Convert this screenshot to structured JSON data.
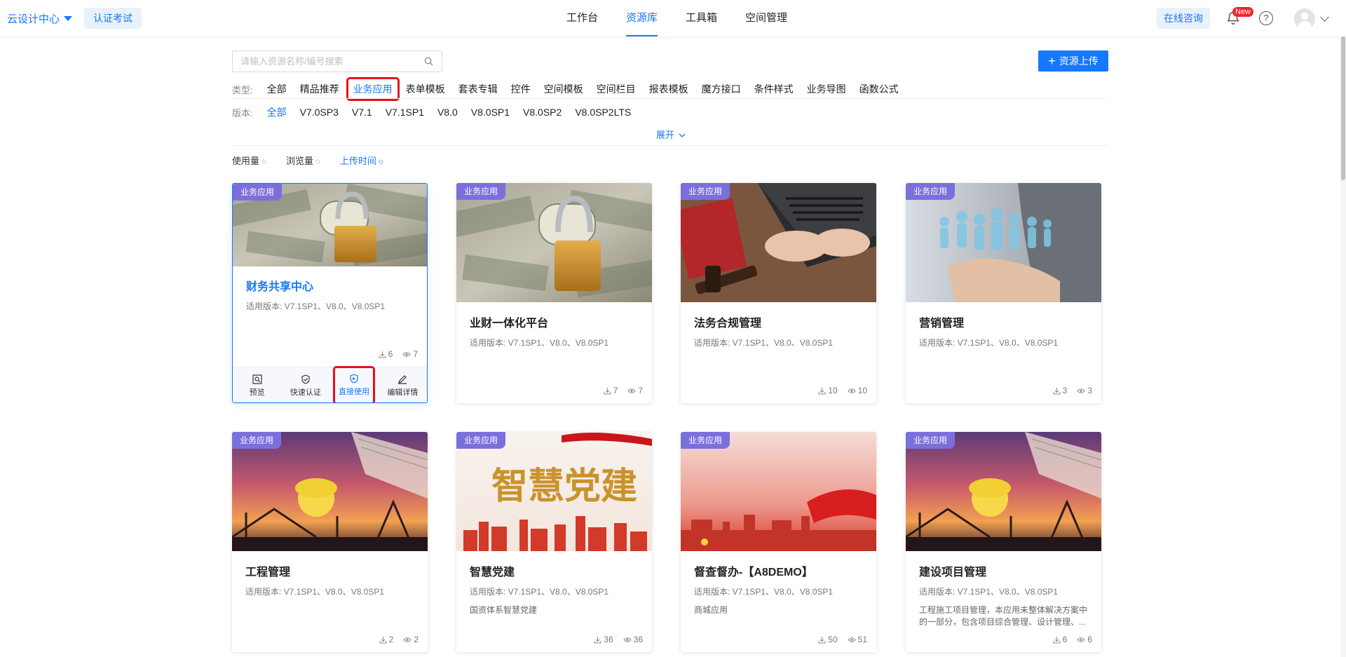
{
  "header": {
    "brand": "云设计中心",
    "cert_button": "认证考试",
    "nav": [
      "工作台",
      "资源库",
      "工具箱",
      "空间管理"
    ],
    "nav_active": "资源库",
    "consult_button": "在线咨询",
    "new_badge": "New",
    "help_symbol": "?"
  },
  "search": {
    "placeholder": "请输入资源名称/编号搜索",
    "upload_label": "资源上传",
    "upload_plus": "+"
  },
  "filters": {
    "type_label": "类型:",
    "types": [
      "全部",
      "精品推荐",
      "业务应用",
      "表单模板",
      "套表专辑",
      "控件",
      "空间模板",
      "空间栏目",
      "报表模板",
      "魔方接口",
      "条件样式",
      "业务导图",
      "函数公式"
    ],
    "type_active": "业务应用",
    "version_label": "版本:",
    "versions": [
      "全部",
      "V7.0SP3",
      "V7.1",
      "V7.1SP1",
      "V8.0",
      "V8.0SP1",
      "V8.0SP2",
      "V8.0SP2LTS"
    ],
    "version_active": "全部",
    "expand": "展开",
    "sorts": [
      "使用量",
      "浏览量",
      "上传时间"
    ],
    "sort_active": "上传时间"
  },
  "cards": [
    {
      "tag": "业务应用",
      "title": "财务共享中心",
      "version": "适用版本: V7.1SP1、V8.0、V8.0SP1",
      "desc": "",
      "downloads": "6",
      "views": "7"
    },
    {
      "tag": "业务应用",
      "title": "业财一体化平台",
      "version": "适用版本: V7.1SP1、V8.0、V8.0SP1",
      "desc": "",
      "downloads": "7",
      "views": "7"
    },
    {
      "tag": "业务应用",
      "title": "法务合规管理",
      "version": "适用版本: V7.1SP1、V8.0、V8.0SP1",
      "desc": "",
      "downloads": "10",
      "views": "10"
    },
    {
      "tag": "业务应用",
      "title": "营销管理",
      "version": "适用版本: V7.1SP1、V8.0、V8.0SP1",
      "desc": "",
      "downloads": "3",
      "views": "3"
    },
    {
      "tag": "业务应用",
      "title": "工程管理",
      "version": "适用版本: V7.1SP1、V8.0、V8.0SP1",
      "desc": "",
      "downloads": "2",
      "views": "2"
    },
    {
      "tag": "业务应用",
      "title": "智慧党建",
      "version": "适用版本: V7.1SP1、V8.0、V8.0SP1",
      "desc": "国资体系智慧党建",
      "downloads": "36",
      "views": "36"
    },
    {
      "tag": "业务应用",
      "title": "督查督办-【A8DEMO】",
      "version": "适用版本: V7.1SP1、V8.0、V8.0SP1",
      "desc": "商城应用",
      "downloads": "50",
      "views": "51"
    },
    {
      "tag": "业务应用",
      "title": "建设项目管理",
      "version": "适用版本: V7.1SP1、V8.0、V8.0SP1",
      "desc": "工程施工项目管理，本应用未整体解决方案中的一部分，包含项目综合管理、设计管理、...",
      "downloads": "6",
      "views": "6"
    }
  ],
  "hover_actions": [
    "预览",
    "快速认证",
    "直接使用",
    "编辑详情"
  ],
  "image_text": {
    "party": "智慧党建"
  },
  "colors": {
    "accent": "#1677ff",
    "tag_bg": "#7b6fdc",
    "highlight": "#e8101c"
  }
}
